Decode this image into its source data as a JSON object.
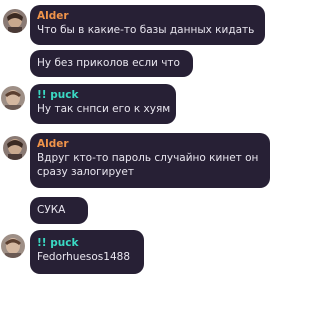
{
  "colors": {
    "bubble": "#272035",
    "text": "#e9e6ef",
    "alder": "#f0944a",
    "puck": "#3ad9c3"
  },
  "messages": [
    {
      "author": "Alder",
      "text": "Что бы в какие-то базы данных кидать"
    },
    {
      "text": "Ну без приколов если что"
    },
    {
      "author": "!! puck",
      "text": "Ну так снпси его к хуям"
    },
    {
      "author": "Alder",
      "text": "Вдруг кто-то пароль случайно кинет он сразу залогирует"
    },
    {
      "text": "СУКА"
    },
    {
      "author": "!! puck",
      "text": "Fedorhuesos1488"
    }
  ]
}
